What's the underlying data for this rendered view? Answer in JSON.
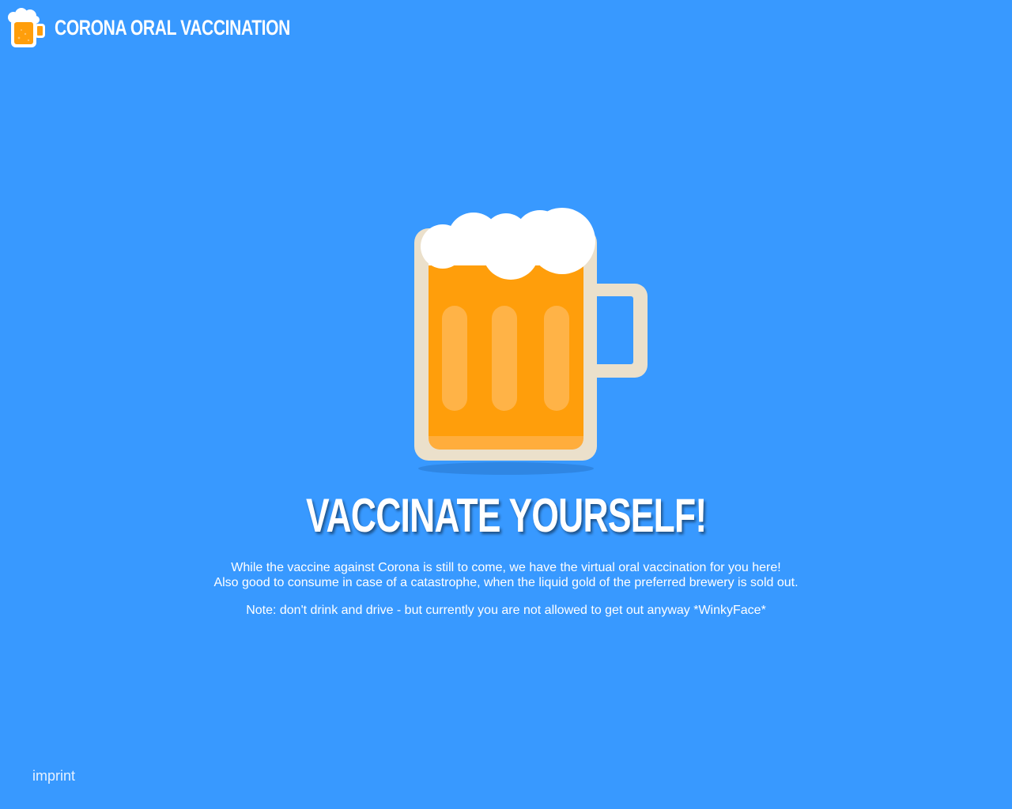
{
  "header": {
    "logo_icon": "beer-mug-icon",
    "site_title": "CORONA ORAL VACCINATION"
  },
  "hero": {
    "image_icon": "beer-mug-icon",
    "title": "VACCINATE YOURSELF!",
    "intro_line_1": "While the vaccine against Corona is still to come, we have the virtual oral vaccination for you here!",
    "intro_line_2": "Also good to consume in case of a catastrophe, when the liquid gold of the preferred brewery is sold out.",
    "note": "Note: don't drink and drive - but currently you are not allowed to get out anyway *WinkyFace*"
  },
  "footer": {
    "imprint_label": "imprint"
  },
  "colors": {
    "background": "#3899ff",
    "beer": "#ff9e0b",
    "glass": "#ebe0cb",
    "foam": "#ffffff",
    "shadow": "#2f86e3"
  }
}
